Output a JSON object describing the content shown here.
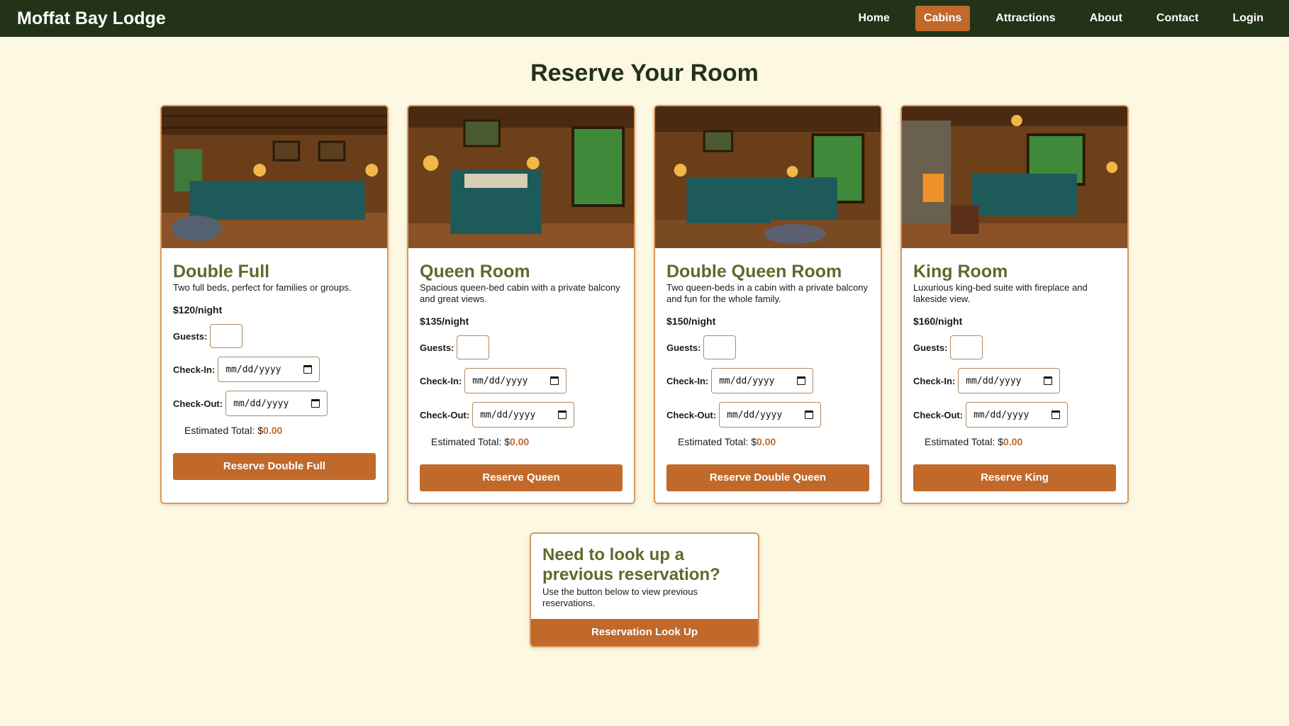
{
  "header": {
    "brand": "Moffat Bay Lodge",
    "nav": [
      "Home",
      "Cabins",
      "Attractions",
      "About",
      "Contact",
      "Login"
    ],
    "active": "Cabins"
  },
  "page": {
    "title": "Reserve Your Room"
  },
  "form_labels": {
    "guests": "Guests:",
    "checkin": "Check-In:",
    "checkout": "Check-Out:",
    "date_placeholder": "mm/dd/yyyy",
    "estimated_prefix": "Estimated Total: $"
  },
  "rooms": [
    {
      "title": "Double Full",
      "desc": "Two full beds, perfect for families or groups.",
      "price": "$120/night",
      "total": "0.00",
      "button": "Reserve Double Full",
      "image": "rustic-cabin-two-full-beds"
    },
    {
      "title": "Queen Room",
      "desc": "Spacious queen-bed cabin with a private balcony and great views.",
      "price": "$135/night",
      "total": "0.00",
      "button": "Reserve Queen",
      "image": "rustic-cabin-queen-bed"
    },
    {
      "title": "Double Queen Room",
      "desc": "Two queen-beds in a cabin with a private balcony and fun for the whole family.",
      "price": "$150/night",
      "total": "0.00",
      "button": "Reserve Double Queen",
      "image": "rustic-cabin-two-queen-beds"
    },
    {
      "title": "King Room",
      "desc": "Luxurious king-bed suite with fireplace and lakeside view.",
      "price": "$160/night",
      "total": "0.00",
      "button": "Reserve King",
      "image": "rustic-cabin-king-bed-fireplace"
    }
  ],
  "lookup": {
    "title": "Need to look up a previous reservation?",
    "desc": "Use the button below to view previous reservations.",
    "button": "Reservation Look Up"
  },
  "colors": {
    "header_bg": "#223318",
    "accent": "#c0692a",
    "page_bg": "#fdf8e1",
    "card_title": "#5f6a2c"
  }
}
